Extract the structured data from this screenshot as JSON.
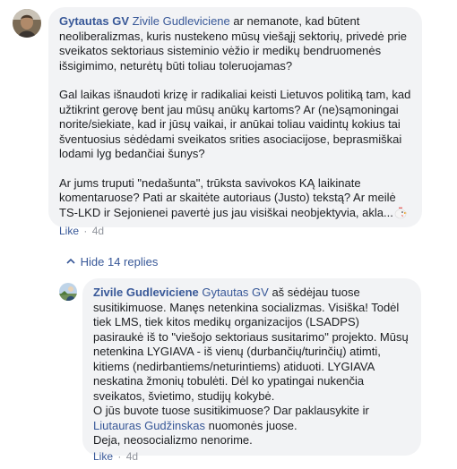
{
  "comment1": {
    "author": "Gytautas GV",
    "mention": "Zivile Gudleviciene",
    "paragraph1": " ar nemanote, kad būtent neoliberalizmas, kuris nustekeno mūsų viešąjį sektorių, privedė prie sveikatos sektoriaus sisteminio vėžio ir medikų bendruomenės išsigimimo, neturėtų būti toliau toleruojamas?",
    "paragraph2": "Gal laikas išnaudoti krizę ir radikaliai keisti Lietuvos politiką tam, kad užtikrint gerovę bent jau mūsų anūkų kartoms? Ar (ne)sąmoningai norite/siekiate, kad ir jūsų vaikai, ir anūkai toliau vaidintų kokius tai šventuosius sėdėdami sveikatos srities asociacijose, beprasmiškai lodami lyg bedančiai šunys?",
    "paragraph3": "Ar jums truputi \"nedašunta\", trūksta savivokos KĄ laikinate komentaruose? Pati ar skaitėte autoriaus (Justo) tekstą? Ar meilė TS-LKD ir Sejonienei pavertė jus jau visiškai neobjektyvia, akla...",
    "emoji_icon": "rooster-emoji",
    "like_label": "Like",
    "separator": "·",
    "time": "4d"
  },
  "replies_toggle": {
    "chevron_icon": "chevron-up-icon",
    "label": "Hide 14 replies"
  },
  "comment2": {
    "author": "Zivile Gudleviciene",
    "mention": "Gytautas GV",
    "text_part1": " aš sėdėjau tuose susitikimuose. Manęs netenkina socializmas. Visiška! Todėl tiek LMS, tiek kitos medikų organizacijos (LSADPS) pasiraukė iš to \"viešojo sektoriaus susitarimo\" projekto. Mūsų netenkina LYGIAVA - iš vienų (durbančių/turinčių) atimti, kitiems (nedirbantiems/neturintiems) atiduoti. LYGIAVA neskatina žmonių tobulėti. Dėl ko ypatingai nukenčia sveikatos, švietimo, studijų kokybė.",
    "text_part2": "O jūs buvote tuose susitikimuose? Dar paklausykite ir ",
    "mention2": "Liutauras Gudžinskas",
    "text_part3": " nuomonės juose.",
    "text_part4": "Deja, neosocializmo nenorime.",
    "like_label": "Like",
    "separator": "·",
    "time": "4d"
  },
  "colors": {
    "link": "#385898",
    "bubble_bg": "#f2f3f5",
    "meta_gray": "#90949c"
  }
}
